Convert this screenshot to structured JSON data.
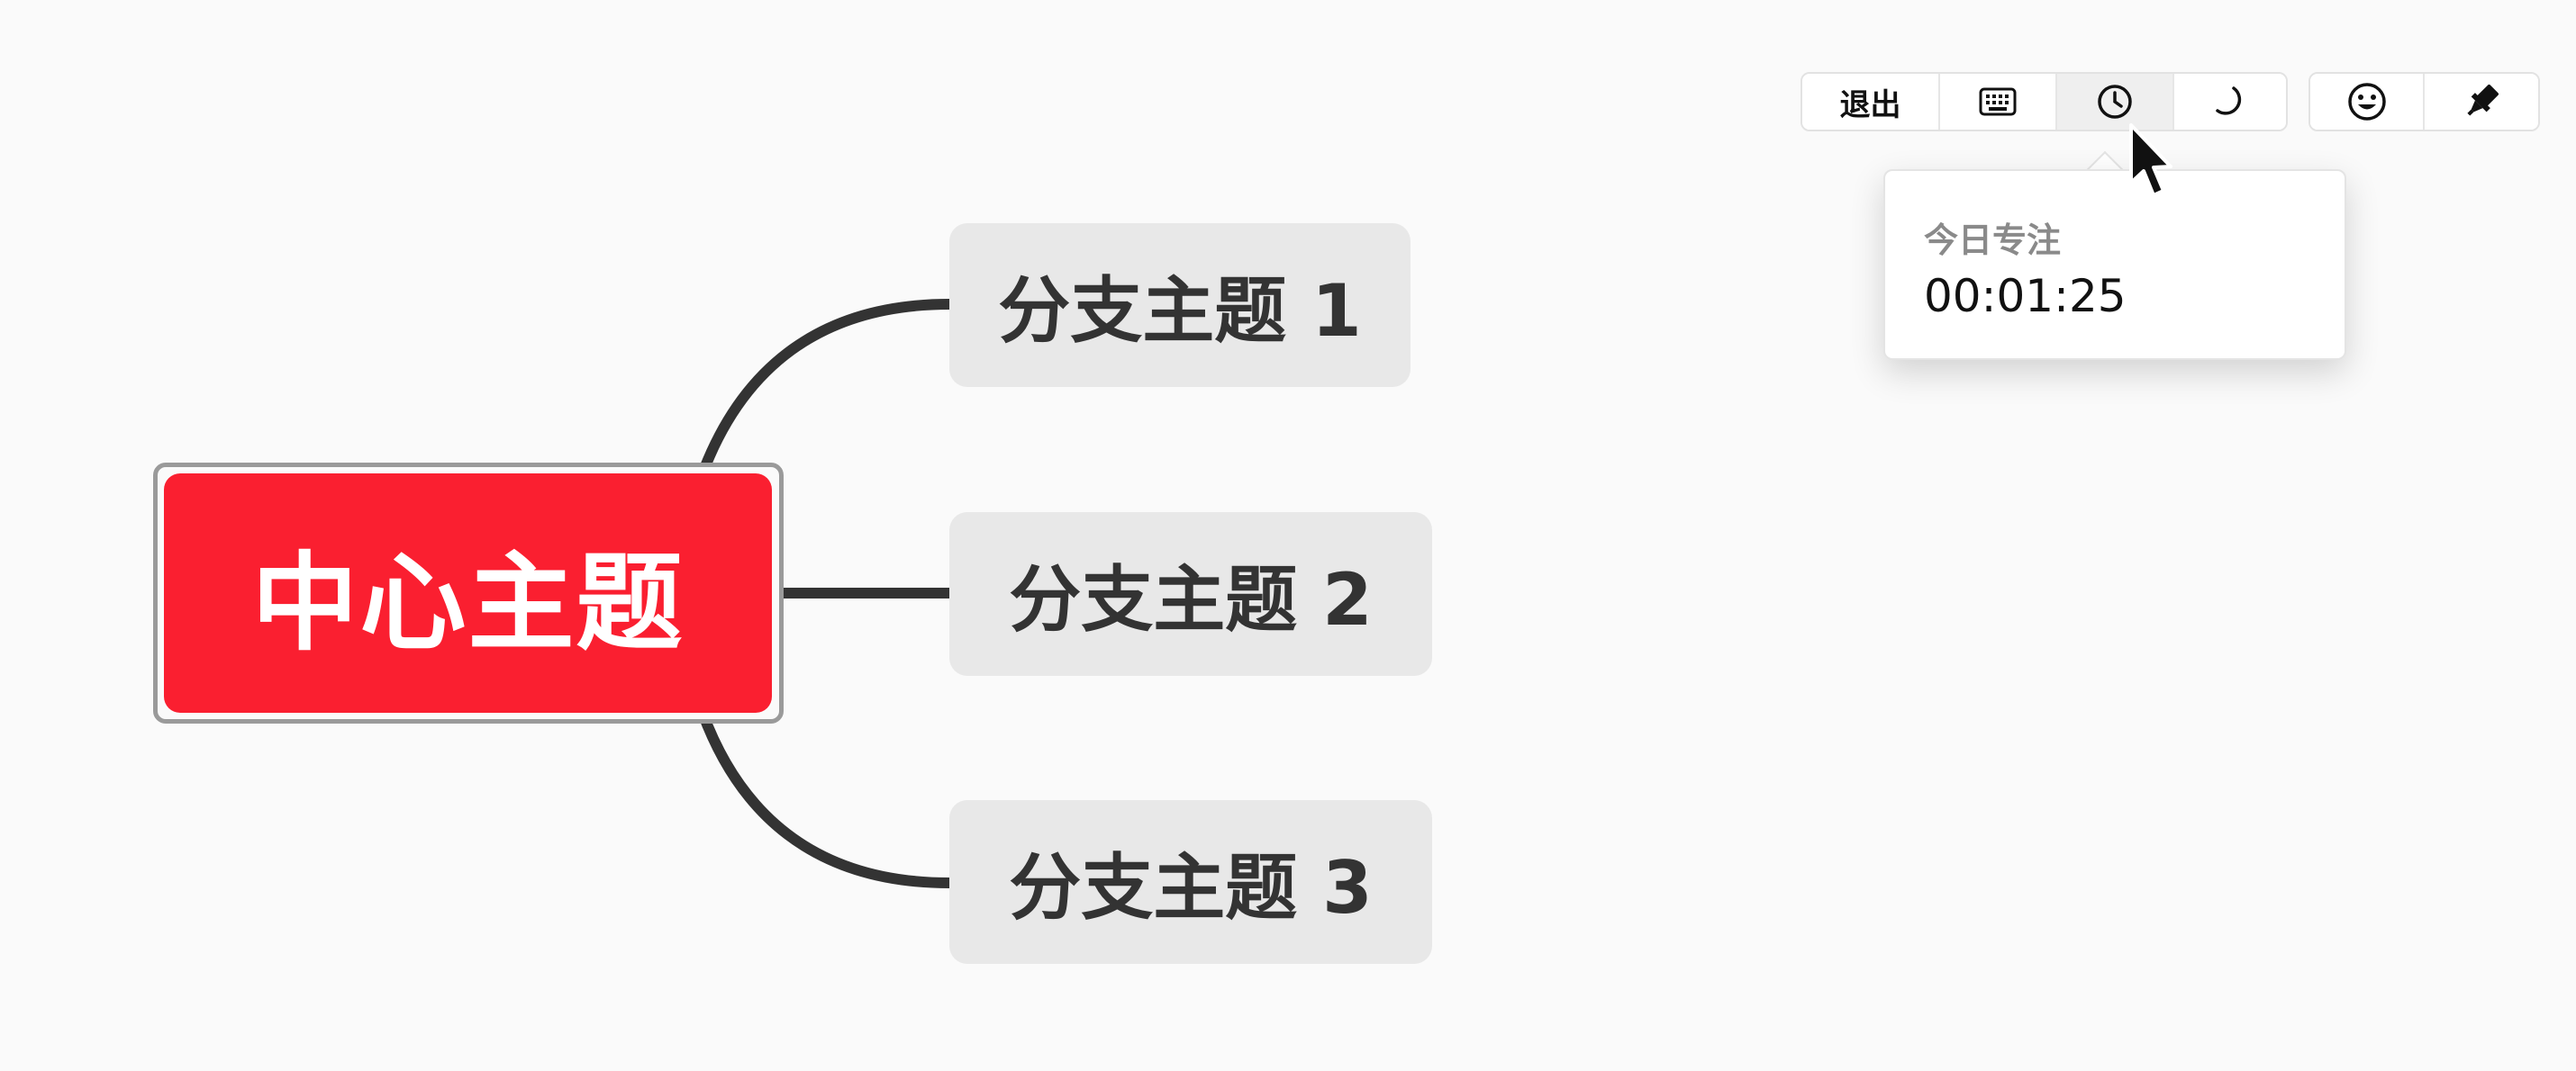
{
  "mindmap": {
    "central_topic": "中心主题",
    "branches": [
      {
        "label": "分支主题 1"
      },
      {
        "label": "分支主题 2"
      },
      {
        "label": "分支主题 3"
      }
    ],
    "colors": {
      "central": "#fa1f30",
      "branch_bg": "#e8e8e8",
      "connector": "#333333",
      "canvas": "#fafafa"
    }
  },
  "toolbar": {
    "exit_label": "退出",
    "buttons": [
      {
        "icon": "keyboard-icon"
      },
      {
        "icon": "clock-icon",
        "active": true
      },
      {
        "icon": "moon-icon"
      },
      {
        "icon": "smiley-icon"
      },
      {
        "icon": "highlighter-icon"
      }
    ]
  },
  "focus_popover": {
    "label": "今日专注",
    "value": "00:01:25"
  }
}
